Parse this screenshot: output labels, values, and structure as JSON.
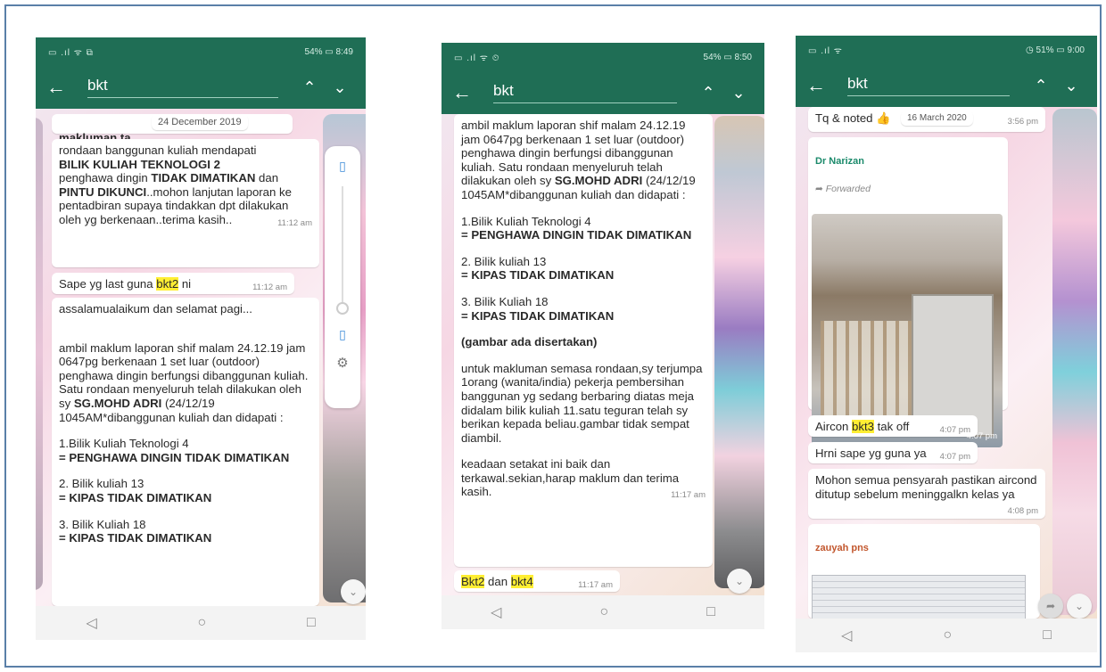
{
  "phone1": {
    "status_left": "▭ .ıl ᯤ ⧉",
    "status_right": "54% ▭ 8:49",
    "search_value": "bkt",
    "date_chip": "24 December 2019",
    "msg0_head": "makluman ta",
    "msg1": {
      "t1": "rondaan banggunan kuliah mendapati",
      "b1": "BILIK KULIAH TEKNOLOGI 2",
      "t2": "penghawa dingin",
      "b2": "TIDAK DIMATIKAN",
      "t3": "dan",
      "b3": "PINTU DIKUNCI",
      "t4": "..mohon lanjutan laporan ke pentadbiran supaya tindakkan dpt dilakukan oleh yg berkenaan..terima kasih..",
      "time": "11:12 am"
    },
    "msg2": {
      "pre": "Sape yg last guna ",
      "hl": "bkt2",
      "post": " ni",
      "time": "11:12 am"
    },
    "msg3": {
      "greet": "assalamualaikum dan selamat pagi...",
      "t1": "ambil maklum laporan shif malam 24.12.19 jam 0647pg berkenaan 1 set luar (outdoor) penghawa dingin berfungsi dibanggunan kuliah. Satu rondaan menyeluruh telah dilakukan oleh sy",
      "b1": "SG.MOHD ADRI",
      "t2": "(24/12/19 1045AM*dibanggunan kuliah dan didapati :",
      "i1": "1.Bilik Kuliah Teknologi 4",
      "i1b": "= PENGHAWA DINGIN TIDAK DIMATIKAN",
      "i2": "2. Bilik kuliah 13",
      "i2b": "= KIPAS TIDAK DIMATIKAN",
      "i3": "3. Bilik Kuliah 18",
      "i3b": "= KIPAS TIDAK DIMATIKAN"
    }
  },
  "phone2": {
    "status_left": "▭ .ıl ᯤ ⏲",
    "status_right": "54% ▭ 8:50",
    "search_value": "bkt",
    "msg1": {
      "t1": "ambil maklum laporan shif malam 24.12.19 jam 0647pg berkenaan 1 set luar (outdoor) penghawa dingin berfungsi dibanggunan kuliah. Satu rondaan menyeluruh telah dilakukan oleh sy",
      "b1": "SG.MOHD ADRI",
      "t2": "(24/12/19 1045AM*dibanggunan kuliah dan didapati :",
      "i1": "1.Bilik Kuliah Teknologi 4",
      "i1b": "= PENGHAWA DINGIN TIDAK DIMATIKAN",
      "i2": "2. Bilik kuliah 13",
      "i2b": "= KIPAS TIDAK DIMATIKAN",
      "i3": "3. Bilik Kuliah 18",
      "i3b": "= KIPAS TIDAK DIMATIKAN",
      "note": "(gambar ada disertakan)",
      "t3": "untuk makluman semasa rondaan,sy terjumpa 1orang (wanita/india) pekerja pembersihan banggunan yg sedang berbaring diatas meja didalam bilik kuliah 11.satu teguran telah sy berikan kepada beliau.gambar tidak sempat diambil.",
      "t4": "keadaan setakat ini baik dan terkawal.sekian,harap maklum dan terima kasih.",
      "time": "11:17 am"
    },
    "msg2": {
      "hl1": "Bkt2",
      "mid": " dan ",
      "hl2": "bkt4",
      "time": "11:17 am"
    }
  },
  "phone3": {
    "status_left": "▭ .ıl ᯤ",
    "status_right": "◷ 51% ▭ 9:00",
    "search_value": "bkt",
    "msg1": {
      "text": "Tq & noted 👍",
      "date": "16 March 2020",
      "time": "3:56 pm"
    },
    "msg2": {
      "sender": "Dr Narizan",
      "fwd": "Forwarded",
      "time": "4:07 pm"
    },
    "msg3": {
      "pre": "Aircon ",
      "hl": "bkt3",
      "post": " tak off",
      "time": "4:07 pm"
    },
    "msg4": {
      "text": "Hrni sape yg guna ya",
      "time": "4:07 pm"
    },
    "msg5": {
      "text": "Mohon semua pensyarah pastikan aircond ditutup sebelum meninggalkn kelas ya",
      "time": "4:08 pm"
    },
    "msg6": {
      "sender": "zauyah pns"
    }
  },
  "colors": {
    "header": "#1f6e55",
    "highlight": "#ffee33",
    "sender": "#1b8a6b"
  },
  "icons": [
    "back-arrow-icon",
    "chevron-up-icon",
    "chevron-down-icon",
    "nav-back-icon",
    "nav-home-icon",
    "nav-recent-icon",
    "scroll-down-icon",
    "vibrate-icon",
    "settings-gear-icon",
    "forward-arrow-icon",
    "thumbs-up-icon"
  ]
}
